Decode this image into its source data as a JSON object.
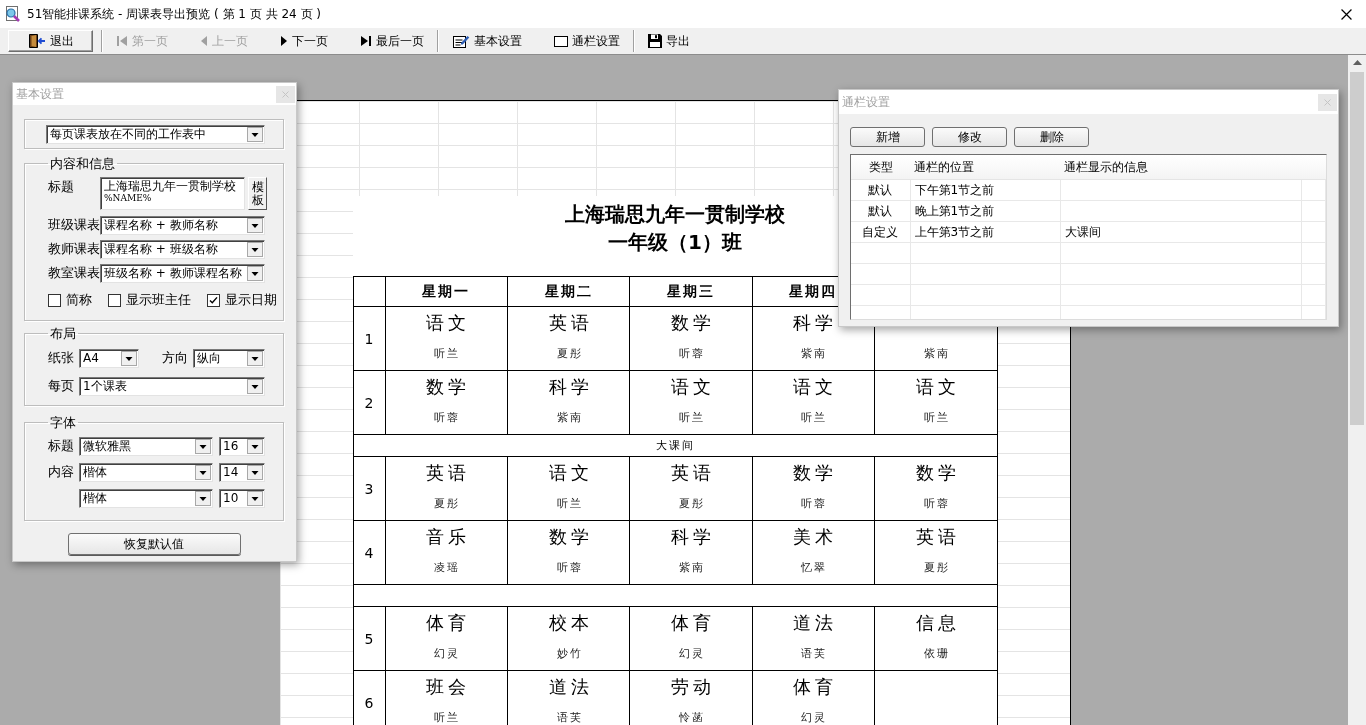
{
  "window": {
    "title": "51智能排课系统 - 周课表导出预览 ( 第 1 页 共 24 页 )"
  },
  "toolbar": [
    {
      "buttons": [
        {
          "kind": "exit",
          "label": "退出",
          "disabled": false,
          "focused": true
        }
      ]
    },
    {
      "buttons": [
        {
          "kind": "first",
          "label": "第一页",
          "disabled": true,
          "focused": false
        },
        {
          "kind": "prev",
          "label": "上一页",
          "disabled": true,
          "focused": false
        },
        {
          "kind": "next",
          "label": "下一页",
          "disabled": false,
          "focused": false
        },
        {
          "kind": "last",
          "label": "最后一页",
          "disabled": false,
          "focused": false
        }
      ]
    },
    {
      "buttons": [
        {
          "kind": "basic_settings",
          "label": "基本设置",
          "disabled": false,
          "focused": false
        },
        {
          "kind": "bar_settings",
          "label": "通栏设置",
          "disabled": false,
          "focused": false
        }
      ]
    },
    {
      "buttons": [
        {
          "kind": "export",
          "label": "导出",
          "disabled": false,
          "focused": false
        }
      ]
    }
  ],
  "preview": {
    "title_lines": [
      "上海瑞思九年一贯制学校",
      "一年级（1）班"
    ],
    "days": [
      "星期一",
      "星期二",
      "星期三",
      "星期四"
    ],
    "rows": [
      {
        "kind": "lesson",
        "period": "1",
        "cells": [
          {
            "subject": "语文",
            "teacher": "听兰"
          },
          {
            "subject": "英语",
            "teacher": "夏彤"
          },
          {
            "subject": "数学",
            "teacher": "听蓉"
          },
          {
            "subject": "科学",
            "teacher": "紫南"
          },
          {
            "teacher": "紫南"
          }
        ]
      },
      {
        "kind": "lesson",
        "period": "2",
        "cells": [
          {
            "subject": "数学",
            "teacher": "听蓉"
          },
          {
            "subject": "科学",
            "teacher": "紫南"
          },
          {
            "subject": "语文",
            "teacher": "听兰"
          },
          {
            "subject": "语文",
            "teacher": "听兰"
          },
          {
            "subject": "语文",
            "teacher": "听兰"
          }
        ]
      },
      {
        "kind": "break",
        "label": "大课间"
      },
      {
        "kind": "lesson",
        "period": "3",
        "cells": [
          {
            "subject": "英语",
            "teacher": "夏彤"
          },
          {
            "subject": "语文",
            "teacher": "听兰"
          },
          {
            "subject": "英语",
            "teacher": "夏彤"
          },
          {
            "subject": "数学",
            "teacher": "听蓉"
          },
          {
            "subject": "数学",
            "teacher": "听蓉"
          }
        ]
      },
      {
        "kind": "lesson",
        "period": "4",
        "cells": [
          {
            "subject": "音乐",
            "teacher": "凌瑶"
          },
          {
            "subject": "数学",
            "teacher": "听蓉"
          },
          {
            "subject": "科学",
            "teacher": "紫南"
          },
          {
            "subject": "美术",
            "teacher": "忆翠"
          },
          {
            "subject": "英语",
            "teacher": "夏彤"
          }
        ]
      },
      {
        "kind": "break"
      },
      {
        "kind": "lesson",
        "period": "5",
        "cells": [
          {
            "subject": "体育",
            "teacher": "幻灵"
          },
          {
            "subject": "校本",
            "teacher": "妙竹"
          },
          {
            "subject": "体育",
            "teacher": "幻灵"
          },
          {
            "subject": "道法",
            "teacher": "语芙"
          },
          {
            "subject": "信息",
            "teacher": "依珊"
          }
        ]
      },
      {
        "kind": "lesson",
        "period": "6",
        "cells": [
          {
            "subject": "班会",
            "teacher": "听兰"
          },
          {
            "subject": "道法",
            "teacher": "语芙"
          },
          {
            "subject": "劳动",
            "teacher": "怜菡"
          },
          {
            "subject": "体育",
            "teacher": "幻灵"
          },
          {}
        ]
      }
    ]
  },
  "basic_settings": {
    "title": "基本设置",
    "sheet_mode": "每页课表放在不同的工作表中",
    "content": {
      "legend": "内容和信息",
      "title_label": "标题",
      "title_lines": [
        "上海瑞思九年一贯制学校",
        "%NAME%"
      ],
      "template_button": "模板",
      "dropdowns": [
        {
          "label": "班级课表",
          "value": "课程名称 + 教师名称"
        },
        {
          "label": "教师课表",
          "value": "课程名称 + 班级名称"
        },
        {
          "label": "教室课表",
          "value": "班级名称 + 教师课程名称"
        }
      ],
      "checkboxes": [
        {
          "label": "简称",
          "checked": false
        },
        {
          "label": "显示班主任",
          "checked": false
        },
        {
          "label": "显示日期",
          "checked": true
        }
      ]
    },
    "layout": {
      "legend": "布局",
      "paper_label": "纸张",
      "paper": "A4",
      "orientation_label": "方向",
      "orientation": "纵向",
      "per_page_label": "每页",
      "per_page": "1个课表"
    },
    "font": {
      "legend": "字体",
      "rows": [
        {
          "label": "标题",
          "family": "微软雅黑",
          "size": "16"
        },
        {
          "label": "内容",
          "family": "楷体",
          "size": "14"
        },
        {
          "family": "楷体",
          "size": "10"
        }
      ]
    },
    "reset_button": "恢复默认值"
  },
  "bar_settings": {
    "title": "通栏设置",
    "buttons": [
      "新增",
      "修改",
      "删除"
    ],
    "columns": [
      "类型",
      "通栏的位置",
      "通栏显示的信息"
    ],
    "rows": [
      {
        "type": "默认",
        "position": "下午第1节之前"
      },
      {
        "type": "默认",
        "position": "晚上第1节之前"
      },
      {
        "type": "自定义",
        "position": "上午第3节之前",
        "info": "大课间"
      }
    ]
  }
}
